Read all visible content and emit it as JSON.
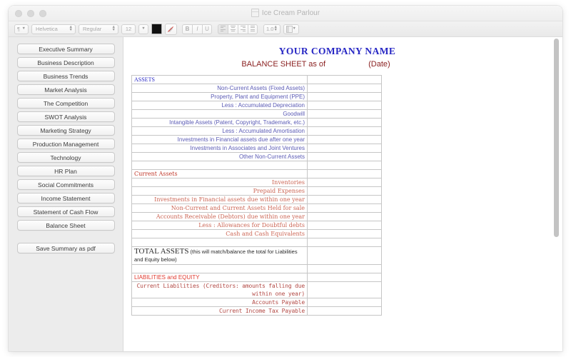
{
  "window": {
    "title": "Ice Cream Parlour",
    "doc_icon": "document-icon",
    "traffic_lights": [
      "close",
      "minimize",
      "zoom"
    ]
  },
  "toolbar": {
    "paragraph_style": "¶",
    "font_family": "Helvetica",
    "font_style": "Regular",
    "font_size": "12",
    "text_color": "#111111",
    "bold_label": "B",
    "italic_label": "I",
    "underline_label": "U",
    "line_spacing": "1.0",
    "highlighter_icon": "highlighter-pen-icon",
    "list_icon": "list-style-icon",
    "align_icons": [
      "align-left-icon",
      "align-center-icon",
      "align-right-icon",
      "align-justify-icon"
    ]
  },
  "sidebar": {
    "items": [
      {
        "label": "Executive Summary"
      },
      {
        "label": "Business Description"
      },
      {
        "label": "Business Trends"
      },
      {
        "label": "Market Analysis"
      },
      {
        "label": "The Competition"
      },
      {
        "label": "SWOT Analysis"
      },
      {
        "label": "Marketing Strategy"
      },
      {
        "label": "Production Management"
      },
      {
        "label": "Technology"
      },
      {
        "label": "HR Plan"
      },
      {
        "label": "Social Commitments"
      },
      {
        "label": "Income Statement"
      },
      {
        "label": "Statement of Cash Flow"
      },
      {
        "label": "Balance Sheet"
      }
    ],
    "save_button": "Save Summary as pdf"
  },
  "document": {
    "company_name": "YOUR COMPANY NAME",
    "subtitle": "BALANCE SHEET as of",
    "date_placeholder": "(Date)",
    "colors": {
      "company_blue": "#2727c4",
      "subtitle_red": "#8b2222",
      "assets_blue": "#2727c4",
      "noncurrent_indigo": "#5b5bb5",
      "current_red": "#c0392b",
      "current_rows_red": "#cc6655",
      "liabilities_red": "#e03a2f",
      "liabilities_rows_red": "#b34a45"
    },
    "sections": [
      {
        "id": "assets",
        "heading": "ASSETS",
        "heading_style": "sec-assets",
        "row_style": "row-noncurrent",
        "rows": [
          "Non-Current Assets (Fixed Assets)",
          "Property, Plant and Equipment (PPE)",
          "Less : Accumulated Depreciation",
          "Goodwill",
          "Intangible Assets (Patent, Copyright, Trademark, etc.)",
          "Less : Accumulated Amortisation",
          "Investments in Financial assets due after one year",
          "Investments in Associates and Joint Ventures",
          "Other Non-Current Assets"
        ]
      },
      {
        "id": "current-assets",
        "heading": "Current Assets",
        "heading_style": "sec-current",
        "row_style": "row-currentassets",
        "rows": [
          "Inventories",
          "Prepaid Expenses",
          "Investments in Financial assets due within one year",
          "Non-Current and Current Assets Held for sale",
          "Accounts Receivable (Debtors) due within one year",
          "Less : Allowances for Doubtful debts",
          "Cash and Cash Equivalents"
        ]
      }
    ],
    "total_assets": {
      "big": "TOTAL ASSETS",
      "small": " (this will match/balance the total for Liabilities and Equity below)"
    },
    "liabilities": {
      "heading": "LIABILITIES and EQUITY",
      "rows": [
        "Current Liabilities (Creditors: amounts falling due within one year)",
        "Accounts Payable",
        "Current Income Tax Payable"
      ]
    }
  },
  "scrollbar": {
    "orientation": "vertical",
    "thumb_position": "top"
  }
}
